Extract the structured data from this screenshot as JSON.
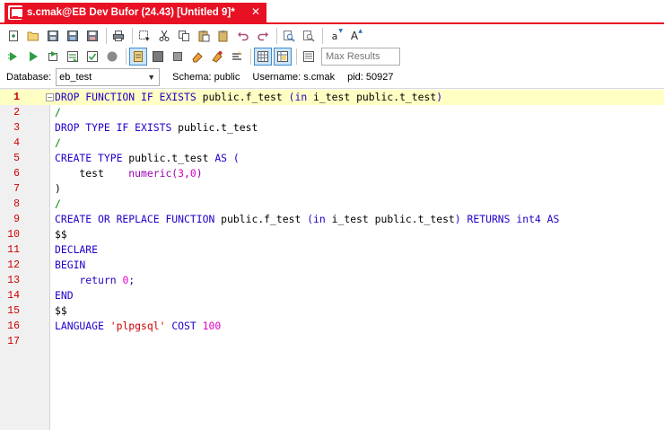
{
  "tab": {
    "title": "s.cmak@EB Dev Bufor (24.43) [Untitled 9]*",
    "close": "✕"
  },
  "toolbar": {
    "row1": [
      "new-file",
      "open-file",
      "save",
      "save-as",
      "save-all",
      "print",
      "select-region",
      "cut",
      "copy",
      "paste",
      "paste-special",
      "undo",
      "redo",
      "find",
      "find-replace",
      "lowercase",
      "uppercase"
    ],
    "row2": [
      "execute-script",
      "execute",
      "execute-step",
      "explain-plan",
      "commit",
      "stop",
      "toggle-mode",
      "rollback",
      "gray",
      "clear",
      "compile",
      "format",
      "grid-view",
      "text-view",
      "history"
    ],
    "max_results_placeholder": "Max Results",
    "lowercase_label": "a",
    "uppercase_label": "A"
  },
  "info": {
    "database_label": "Database:",
    "database_value": "eb_test",
    "schema": "Schema:  public",
    "username": "Username:  s.cmak",
    "pid": "pid:   50927"
  },
  "editor": {
    "current_line": 1,
    "lines": [
      {
        "n": "1",
        "tokens": [
          {
            "t": "DROP FUNCTION IF EXISTS ",
            "c": "kw"
          },
          {
            "t": "public.f_test ",
            "c": ""
          },
          {
            "t": "(in ",
            "c": "kw"
          },
          {
            "t": "i_test ",
            "c": ""
          },
          {
            "t": "public.t_test",
            "c": ""
          },
          {
            "t": ")",
            "c": "kw"
          }
        ]
      },
      {
        "n": "2",
        "tokens": [
          {
            "t": "/",
            "c": "sl"
          }
        ]
      },
      {
        "n": "3",
        "tokens": [
          {
            "t": "DROP TYPE IF EXISTS ",
            "c": "kw"
          },
          {
            "t": "public.t_test",
            "c": ""
          }
        ]
      },
      {
        "n": "4",
        "tokens": [
          {
            "t": "/",
            "c": "sl"
          }
        ]
      },
      {
        "n": "5",
        "tokens": [
          {
            "t": "CREATE TYPE ",
            "c": "kw"
          },
          {
            "t": "public.t_test ",
            "c": ""
          },
          {
            "t": "AS (",
            "c": "kw"
          }
        ]
      },
      {
        "n": "6",
        "tokens": [
          {
            "t": "    test    ",
            "c": ""
          },
          {
            "t": "numeric(",
            "c": "fn"
          },
          {
            "t": "3",
            "c": "num"
          },
          {
            "t": ",",
            "c": "fn"
          },
          {
            "t": "0",
            "c": "num"
          },
          {
            "t": ")",
            "c": "fn"
          }
        ]
      },
      {
        "n": "7",
        "tokens": [
          {
            "t": ")",
            "c": ""
          }
        ]
      },
      {
        "n": "8",
        "tokens": [
          {
            "t": "/",
            "c": "sl"
          }
        ]
      },
      {
        "n": "9",
        "tokens": [
          {
            "t": "CREATE OR REPLACE FUNCTION ",
            "c": "kw"
          },
          {
            "t": "public.f_test ",
            "c": ""
          },
          {
            "t": "(in ",
            "c": "kw"
          },
          {
            "t": "i_test ",
            "c": ""
          },
          {
            "t": "public.t_test",
            "c": ""
          },
          {
            "t": ") RETURNS int4 AS",
            "c": "kw"
          }
        ]
      },
      {
        "n": "10",
        "tokens": [
          {
            "t": "$$",
            "c": ""
          }
        ]
      },
      {
        "n": "11",
        "tokens": [
          {
            "t": "DECLARE",
            "c": "kw"
          }
        ]
      },
      {
        "n": "12",
        "tokens": [
          {
            "t": "BEGIN",
            "c": "kw"
          }
        ]
      },
      {
        "n": "13",
        "tokens": [
          {
            "t": "    return ",
            "c": "kw"
          },
          {
            "t": "0",
            "c": "num"
          },
          {
            "t": ";",
            "c": "kw"
          }
        ]
      },
      {
        "n": "14",
        "tokens": [
          {
            "t": "END",
            "c": "kw"
          }
        ]
      },
      {
        "n": "15",
        "tokens": [
          {
            "t": "$$",
            "c": ""
          }
        ]
      },
      {
        "n": "16",
        "tokens": [
          {
            "t": "LANGUAGE ",
            "c": "kw"
          },
          {
            "t": "'plpgsql' ",
            "c": "str"
          },
          {
            "t": "COST ",
            "c": "kw"
          },
          {
            "t": "100",
            "c": "num"
          }
        ]
      },
      {
        "n": "17",
        "tokens": []
      }
    ]
  },
  "colors": {
    "accent": "#e81123",
    "keyword": "#1f00c8",
    "number": "#e000c0",
    "string": "#cc0000",
    "slash": "#008000",
    "line_number": "#cc0000",
    "current_line_bg": "#ffffc4"
  }
}
